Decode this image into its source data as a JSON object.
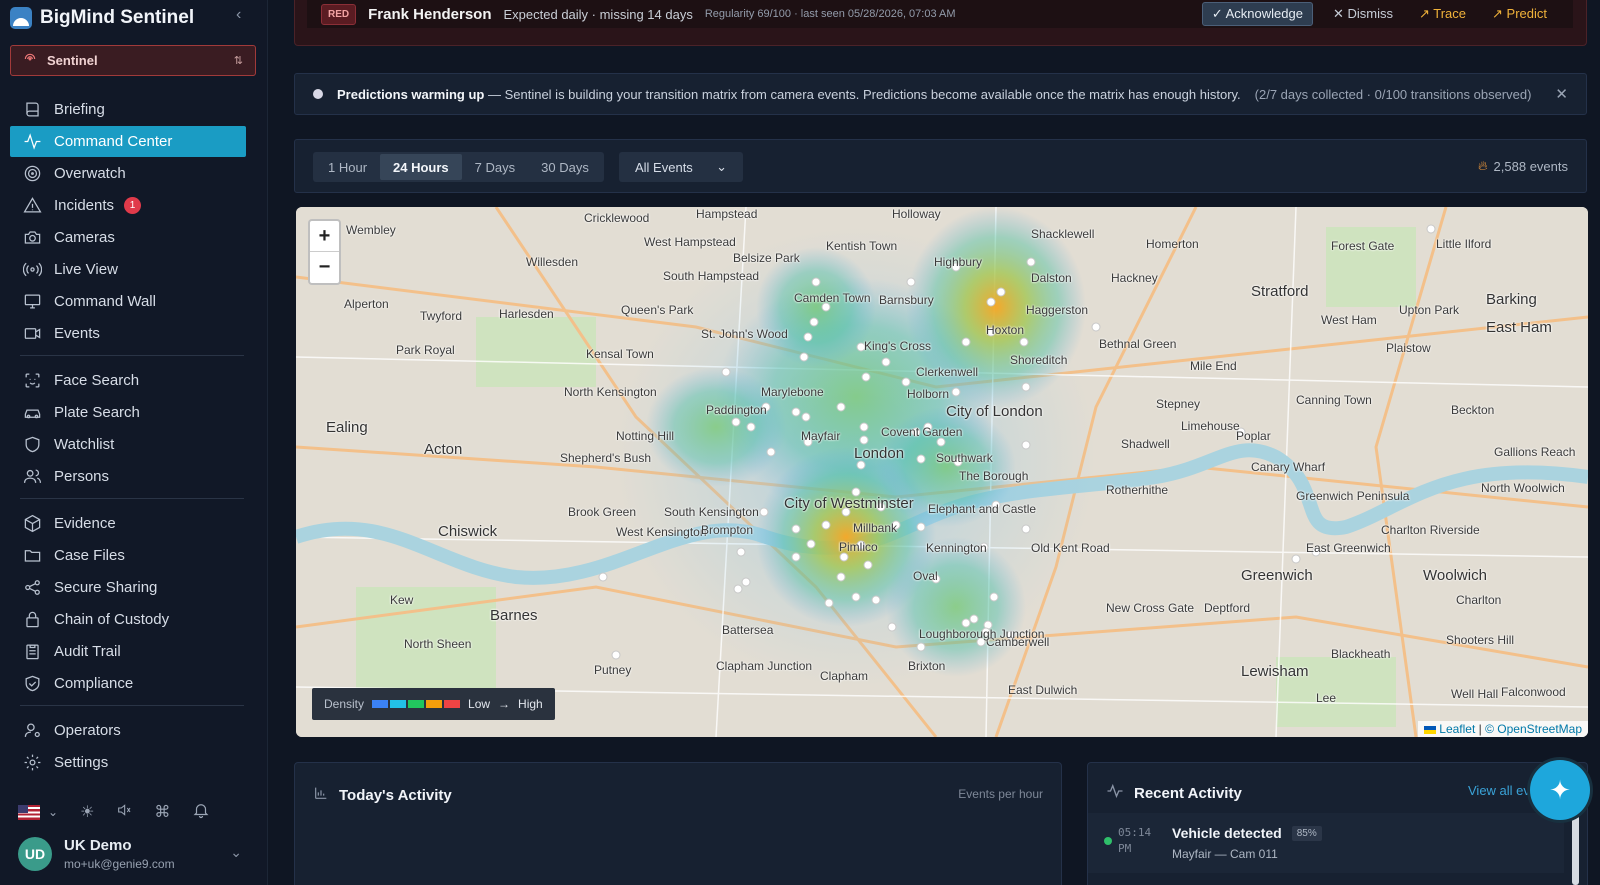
{
  "app": {
    "name": "BigMind Sentinel",
    "workspace": "Sentinel"
  },
  "sidebar": {
    "groups": [
      [
        {
          "label": "Briefing",
          "icon": "book-icon"
        },
        {
          "label": "Command Center",
          "icon": "activity-icon",
          "active": true
        },
        {
          "label": "Overwatch",
          "icon": "radar-icon"
        },
        {
          "label": "Incidents",
          "icon": "alert-triangle-icon",
          "badge": "1"
        },
        {
          "label": "Cameras",
          "icon": "camera-icon"
        },
        {
          "label": "Live View",
          "icon": "broadcast-icon"
        },
        {
          "label": "Command Wall",
          "icon": "monitor-icon"
        },
        {
          "label": "Events",
          "icon": "video-icon"
        }
      ],
      [
        {
          "label": "Face Search",
          "icon": "face-scan-icon"
        },
        {
          "label": "Plate Search",
          "icon": "car-icon"
        },
        {
          "label": "Watchlist",
          "icon": "shield-icon"
        },
        {
          "label": "Persons",
          "icon": "users-icon"
        }
      ],
      [
        {
          "label": "Evidence",
          "icon": "package-icon"
        },
        {
          "label": "Case Files",
          "icon": "folder-icon"
        },
        {
          "label": "Secure Sharing",
          "icon": "share-icon"
        },
        {
          "label": "Chain of Custody",
          "icon": "lock-icon"
        },
        {
          "label": "Audit Trail",
          "icon": "clipboard-icon"
        },
        {
          "label": "Compliance",
          "icon": "shield-check-icon"
        }
      ],
      [
        {
          "label": "Operators",
          "icon": "user-cog-icon"
        },
        {
          "label": "Settings",
          "icon": "gear-icon"
        }
      ]
    ],
    "user": {
      "initials": "UD",
      "name": "UK Demo",
      "email": "mo+uk@genie9.com"
    }
  },
  "alert": {
    "level": "RED",
    "name": "Frank Henderson",
    "description": "Expected daily · missing 14 days",
    "meta": "Regularity 69/100 · last seen 05/28/2026, 07:03 AM",
    "actions": {
      "acknowledge": "Acknowledge",
      "dismiss": "Dismiss",
      "trace": "Trace",
      "predict": "Predict"
    }
  },
  "notice": {
    "title": "Predictions warming up",
    "body": "— Sentinel is building your transition matrix from camera events. Predictions become available once the matrix has enough history.",
    "meta": "(2/7 days collected · 0/100 transitions observed)"
  },
  "toolbar": {
    "ranges": [
      "1 Hour",
      "24 Hours",
      "7 Days",
      "30 Days"
    ],
    "active_range": "24 Hours",
    "filter": "All Events",
    "event_count": "2,588 events"
  },
  "map": {
    "zoom_in": "+",
    "zoom_out": "−",
    "legend": {
      "label": "Density",
      "low": "Low",
      "high": "High",
      "colors": [
        "#3b82f6",
        "#22c1e6",
        "#22c55e",
        "#f59e0b",
        "#ef4444"
      ]
    },
    "attribution": {
      "leaflet": "Leaflet",
      "osm": "© OpenStreetMap"
    },
    "places": [
      "Cricklewood",
      "Hampstead",
      "Holloway",
      "Shacklewell",
      "Wembley",
      "West Hampstead",
      "Kentish Town",
      "Homerton",
      "Forest Gate",
      "Little Ilford",
      "Willesden",
      "South Hampstead",
      "Belsize Park",
      "Highbury",
      "Dalston",
      "Hackney",
      "Stratford",
      "Barking",
      "Alperton",
      "Twyford",
      "Harlesden",
      "Queen's Park",
      "Camden Town",
      "Barnsbury",
      "Haggerston",
      "West Ham",
      "Upton Park",
      "East Ham",
      "Park Royal",
      "Kensal Town",
      "St. John's Wood",
      "King's Cross",
      "Hoxton",
      "Shoreditch",
      "Bethnal Green",
      "Plaistow",
      "North Kensington",
      "Marylebone",
      "Clerkenwell",
      "Mile End",
      "Holborn",
      "City of London",
      "Stepney",
      "Canning Town",
      "Beckton",
      "Ealing",
      "Acton",
      "Notting Hill",
      "Paddington",
      "Mayfair",
      "Covent Garden",
      "London",
      "Limehouse",
      "Poplar",
      "Shadwell",
      "Canary Wharf",
      "Gallions Reach",
      "Shepherd's Bush",
      "Southwark",
      "The Borough",
      "Rotherhithe",
      "North Woolwich",
      "Brook Green",
      "South Kensington",
      "City of Westminster",
      "Elephant and Castle",
      "Greenwich Peninsula",
      "Chiswick",
      "West Kensington",
      "Brompton",
      "Millbank",
      "Pimlico",
      "Kennington",
      "Old Kent Road",
      "Charlton Riverside",
      "East Greenwich",
      "Kew",
      "Oval",
      "Greenwich",
      "Woolwich",
      "Barnes",
      "Battersea",
      "New Cross Gate",
      "Deptford",
      "Charlton",
      "North Sheen",
      "Camberwell",
      "Loughborough Junction",
      "Blackheath",
      "Shooters Hill",
      "Putney",
      "Clapham Junction",
      "Lewisham",
      "Clapham",
      "East Dulwich",
      "Lee",
      "Brixton",
      "Well Hall",
      "Falconwood"
    ]
  },
  "today": {
    "title": "Today's Activity",
    "subtitle": "Events per hour"
  },
  "recent": {
    "title": "Recent Activity",
    "view_all": "View all ev",
    "items": [
      {
        "time": "05:14",
        "ampm": "PM",
        "title": "Vehicle detected",
        "confidence": "85%",
        "location": "Mayfair — Cam 011"
      }
    ]
  }
}
